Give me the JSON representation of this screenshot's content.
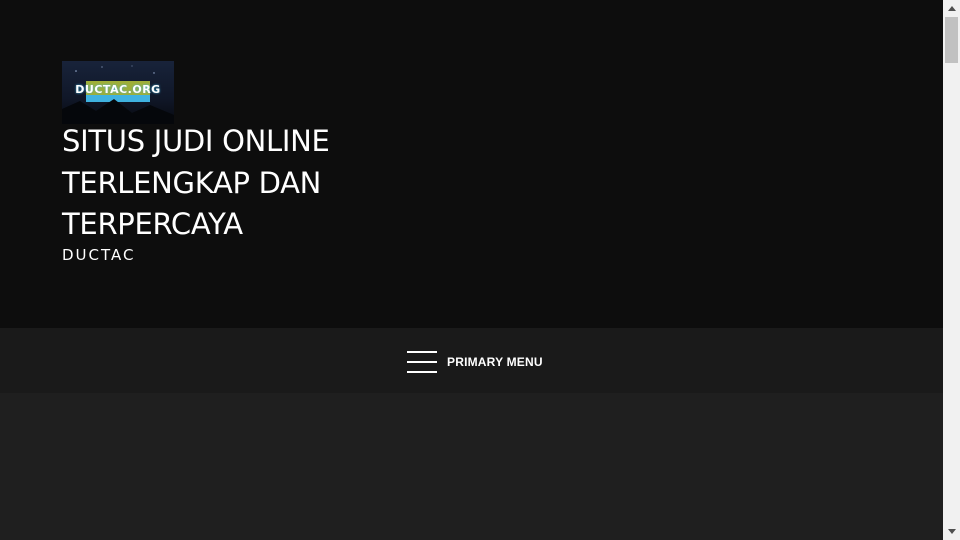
{
  "header": {
    "logo_text": "DUCTAC.ORG",
    "title": "SITUS JUDI ONLINE TERLENGKAP DAN TERPERCAYA",
    "tagline": "DUCTAC"
  },
  "nav": {
    "menu_label": "PRIMARY MENU"
  },
  "colors": {
    "header_bg": "#0d0d0d",
    "nav_bg": "#1a1a1a",
    "content_bg": "#1f1f1f",
    "text": "#ffffff",
    "logo_accent": "#3fb2e0"
  },
  "icons": {
    "menu": "hamburger-icon",
    "scroll_up": "scroll-up-arrow-icon",
    "scroll_down": "scroll-down-arrow-icon"
  }
}
